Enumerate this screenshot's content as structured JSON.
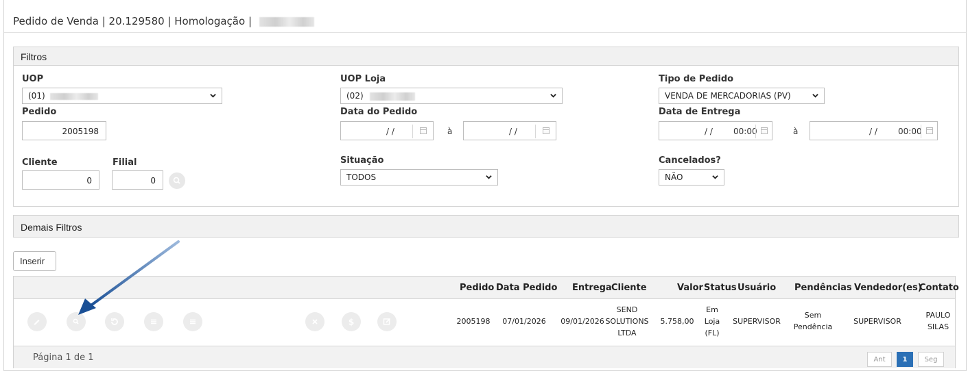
{
  "header": {
    "title": "Pedido de Venda | 20.129580 | Homologação |"
  },
  "filters": {
    "panel_title": "Filtros",
    "uop": {
      "label": "UOP",
      "value": "(01)"
    },
    "uop_loja": {
      "label": "UOP Loja",
      "value": "(02)"
    },
    "tipo_pedido": {
      "label": "Tipo de Pedido",
      "value": "VENDA DE MERCADORIAS (PV)"
    },
    "pedido": {
      "label": "Pedido",
      "value": "2005198"
    },
    "data_pedido": {
      "label": "Data do Pedido",
      "from": "/ /",
      "to": "/ /",
      "sep": "à"
    },
    "data_entrega": {
      "label": "Data de Entrega",
      "from": "/ /",
      "from_time": "00:00",
      "to": "/ /",
      "to_time": "00:00",
      "sep": "à"
    },
    "cliente": {
      "label": "Cliente",
      "value": "0"
    },
    "filial": {
      "label": "Filial",
      "value": "0"
    },
    "situacao": {
      "label": "Situação",
      "value": "TODOS"
    },
    "cancelados": {
      "label": "Cancelados?",
      "value": "NÃO"
    }
  },
  "more_filters": {
    "panel_title": "Demais Filtros"
  },
  "toolbar": {
    "insert_label": "Inserir"
  },
  "table": {
    "headers": {
      "pedido": "Pedido",
      "data_pedido": "Data Pedido",
      "entrega": "Entrega",
      "cliente": "Cliente",
      "valor": "Valor",
      "status": "Status",
      "usuario": "Usuário",
      "pendencias": "Pendências",
      "vendedores": "Vendedor(es)",
      "contato": "Contato"
    },
    "row": {
      "pedido": "2005198",
      "data_pedido": "07/01/2026",
      "entrega": "09/01/2026",
      "cliente_1": "SEND",
      "cliente_2": "SOLUTIONS",
      "cliente_3": "LTDA",
      "valor": "5.758,00",
      "status_1": "Em",
      "status_2": "Loja",
      "status_3": "(FL)",
      "usuario": "SUPERVISOR",
      "pendencias_1": "Sem",
      "pendencias_2": "Pendência",
      "vendedores": "SUPERVISOR",
      "contato_1": "PAULO",
      "contato_2": "SILAS"
    },
    "row_actions": [
      "edit-icon",
      "search-icon",
      "history-icon",
      "list-icon",
      "list-icon",
      "cancel-icon",
      "dollar-icon",
      "edit-note-icon"
    ],
    "footer": {
      "page_info": "Página 1 de 1",
      "prev": "Ant",
      "current": "1",
      "next": "Seg"
    }
  },
  "colors": {
    "accent": "#2b70b6",
    "arrow": "#1f5ea8",
    "panel_bg": "#f1f1f1"
  }
}
